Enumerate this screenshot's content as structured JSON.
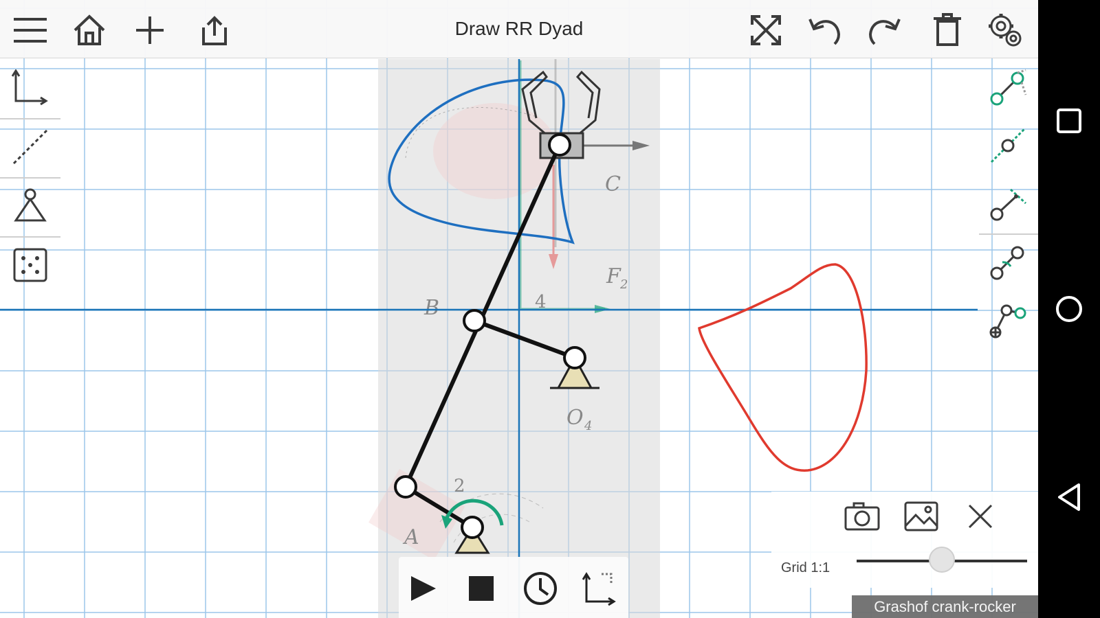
{
  "app": {
    "title": "Draw RR Dyad",
    "status": "Grashof crank-rocker"
  },
  "toolbar": {
    "left_icons": [
      "menu-icon",
      "home-icon",
      "add-icon",
      "share-icon"
    ],
    "right_icons": [
      "fit-screen-icon",
      "undo-icon",
      "redo-icon",
      "delete-icon",
      "settings-icon"
    ]
  },
  "left_tools": [
    "axes-tool-icon",
    "dashed-line-tool-icon",
    "ground-pivot-tool-icon",
    "points-tool-icon"
  ],
  "right_tools": [
    "dyad-tool-icon",
    "slider-joint-tool-icon",
    "rotate-link-tool-icon",
    "input-link-tool-icon",
    "coupler-link-tool-icon"
  ],
  "playback": {
    "icons": [
      "play-icon",
      "stop-icon",
      "timer-icon",
      "axes-icon"
    ]
  },
  "grid_panel": {
    "label": "Grid 1:1",
    "icons": [
      "camera-icon",
      "image-icon",
      "close-icon"
    ],
    "scale_value": 0.5
  },
  "background_image": {
    "labels": {
      "C": "C",
      "F2": "F",
      "F2_sub": "2",
      "B": "B",
      "four": "4",
      "O4": "O",
      "O4_sub": "4",
      "two": "2",
      "A": "A"
    }
  },
  "colors": {
    "grid": "#9cc5ea",
    "axis": "#1b75b8",
    "coupler_curve": "#1e6fc0",
    "output_curve": "#e03a2e",
    "link": "#111111",
    "crank_arrow": "#1aa37a",
    "ground": "#e8dfb5",
    "icon_green": "#1aa37a",
    "icon_dark": "#3c3c3c"
  }
}
